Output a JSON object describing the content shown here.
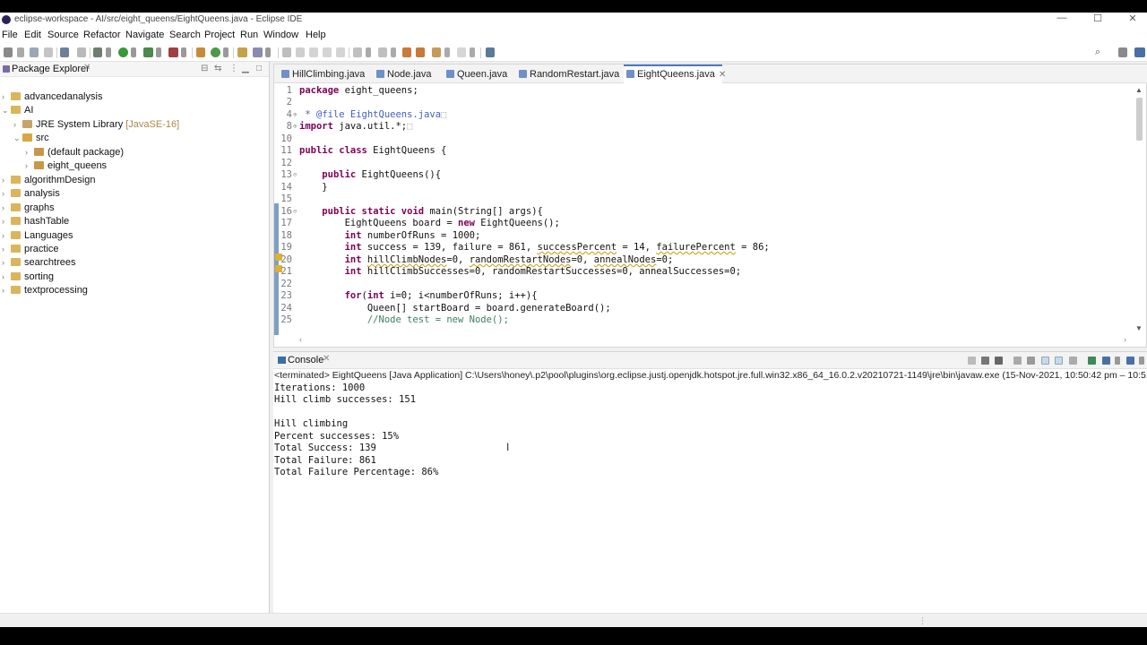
{
  "window": {
    "title": "eclipse-workspace - AI/src/eight_queens/EightQueens.java - Eclipse IDE",
    "minimize": "—",
    "maximize": "☐",
    "close": "✕"
  },
  "menu": [
    "File",
    "Edit",
    "Source",
    "Refactor",
    "Navigate",
    "Search",
    "Project",
    "Run",
    "Window",
    "Help"
  ],
  "package_explorer": {
    "title": "Package Explorer",
    "close": "✕",
    "items": [
      {
        "label": "advancedanalysis",
        "deco": ""
      },
      {
        "label": "AI",
        "deco": ""
      },
      {
        "label": "JRE System Library ",
        "deco": "[JavaSE-16]"
      },
      {
        "label": "src",
        "deco": ""
      },
      {
        "label": "(default package)",
        "deco": ""
      },
      {
        "label": "eight_queens",
        "deco": ""
      },
      {
        "label": "algorithmDesign",
        "deco": ""
      },
      {
        "label": "analysis",
        "deco": ""
      },
      {
        "label": "graphs",
        "deco": ""
      },
      {
        "label": "hashTable",
        "deco": ""
      },
      {
        "label": "Languages",
        "deco": ""
      },
      {
        "label": "practice",
        "deco": ""
      },
      {
        "label": "searchtrees",
        "deco": ""
      },
      {
        "label": "sorting",
        "deco": ""
      },
      {
        "label": "textprocessing",
        "deco": ""
      }
    ]
  },
  "editor": {
    "tabs": [
      {
        "label": "HillClimbing.java"
      },
      {
        "label": "Node.java"
      },
      {
        "label": "Queen.java"
      },
      {
        "label": "RandomRestart.java"
      },
      {
        "label": "EightQueens.java",
        "active": true
      }
    ],
    "lines": [
      {
        "n": "1",
        "t": "package eight_queens;"
      },
      {
        "n": "2",
        "t": ""
      },
      {
        "n": "4",
        "t": " * @file EightQueens.java"
      },
      {
        "n": "8",
        "t": "import java.util.*;"
      },
      {
        "n": "10",
        "t": ""
      },
      {
        "n": "11",
        "t": "public class EightQueens {"
      },
      {
        "n": "12",
        "t": ""
      },
      {
        "n": "13",
        "t": "    public EightQueens(){"
      },
      {
        "n": "14",
        "t": "    }"
      },
      {
        "n": "15",
        "t": ""
      },
      {
        "n": "16",
        "t": "    public static void main(String[] args){"
      },
      {
        "n": "17",
        "t": "        EightQueens board = new EightQueens();"
      },
      {
        "n": "18",
        "t": "        int numberOfRuns = 1000;"
      },
      {
        "n": "19",
        "t": "        int success = 139, failure = 861, successPercent = 14, failurePercent = 86;"
      },
      {
        "n": "20",
        "t": "        int hillClimbNodes=0, randomRestartNodes=0, annealNodes=0;"
      },
      {
        "n": "21",
        "t": "        int hillClimbSuccesses=0, randomRestartSuccesses=0, annealSuccesses=0;"
      },
      {
        "n": "22",
        "t": ""
      },
      {
        "n": "23",
        "t": "        for(int i=0; i<numberOfRuns; i++){"
      },
      {
        "n": "24",
        "t": "            Queen[] startBoard = board.generateBoard();"
      },
      {
        "n": "25",
        "t": "            //Node test = new Node();"
      }
    ]
  },
  "console": {
    "title": "Console",
    "close": "✕",
    "terminated": "<terminated> EightQueens [Java Application] C:\\Users\\honey\\.p2\\pool\\plugins\\org.eclipse.justj.openjdk.hotspot.jre.full.win32.x86_64_16.0.2.v20210721-1149\\jre\\bin\\javaw.exe  (15-Nov-2021, 10:50:42 pm – 10:51:30 pm)",
    "output": [
      "Iterations: 1000",
      "Hill climb successes: 151",
      "",
      "Hill climbing",
      "Percent successes: 15%",
      "Total Success: 139",
      "Total Failure: 861",
      "Total Failure Percentage: 86%"
    ]
  }
}
